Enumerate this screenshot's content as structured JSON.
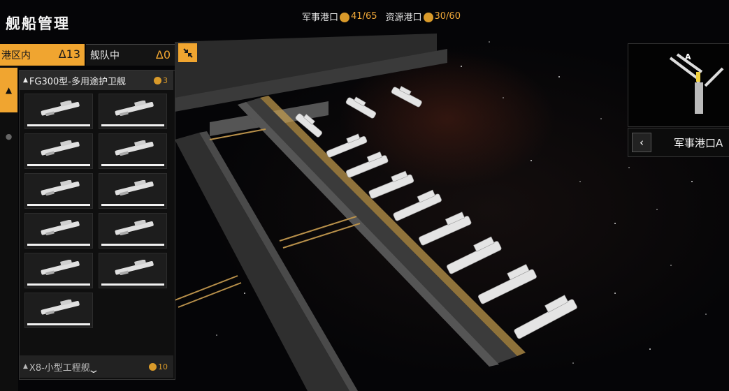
{
  "title": "舰船管理",
  "resources": {
    "military_label": "军事港口",
    "military_value": "41/65",
    "resource_label": "资源港口",
    "resource_value": "30/60"
  },
  "tabs": {
    "in_port": {
      "label": "港区内",
      "count": "Δ13"
    },
    "in_fleet": {
      "label": "舰队中",
      "count": "Δ0"
    }
  },
  "groups": [
    {
      "label": "FG300型-多用途护卫舰",
      "count": "3",
      "ships": 11
    },
    {
      "label": "X8-小型工程舰",
      "count": "10"
    }
  ],
  "minimap": {
    "marker": "A"
  },
  "port": {
    "name": "军事港口A"
  },
  "icons": [
    "collapse-icon",
    "resource-coin-icon",
    "back-chevron-icon",
    "scroll-down-icon"
  ],
  "colors": {
    "accent": "#f0a530",
    "coin": "#d99a2a"
  }
}
